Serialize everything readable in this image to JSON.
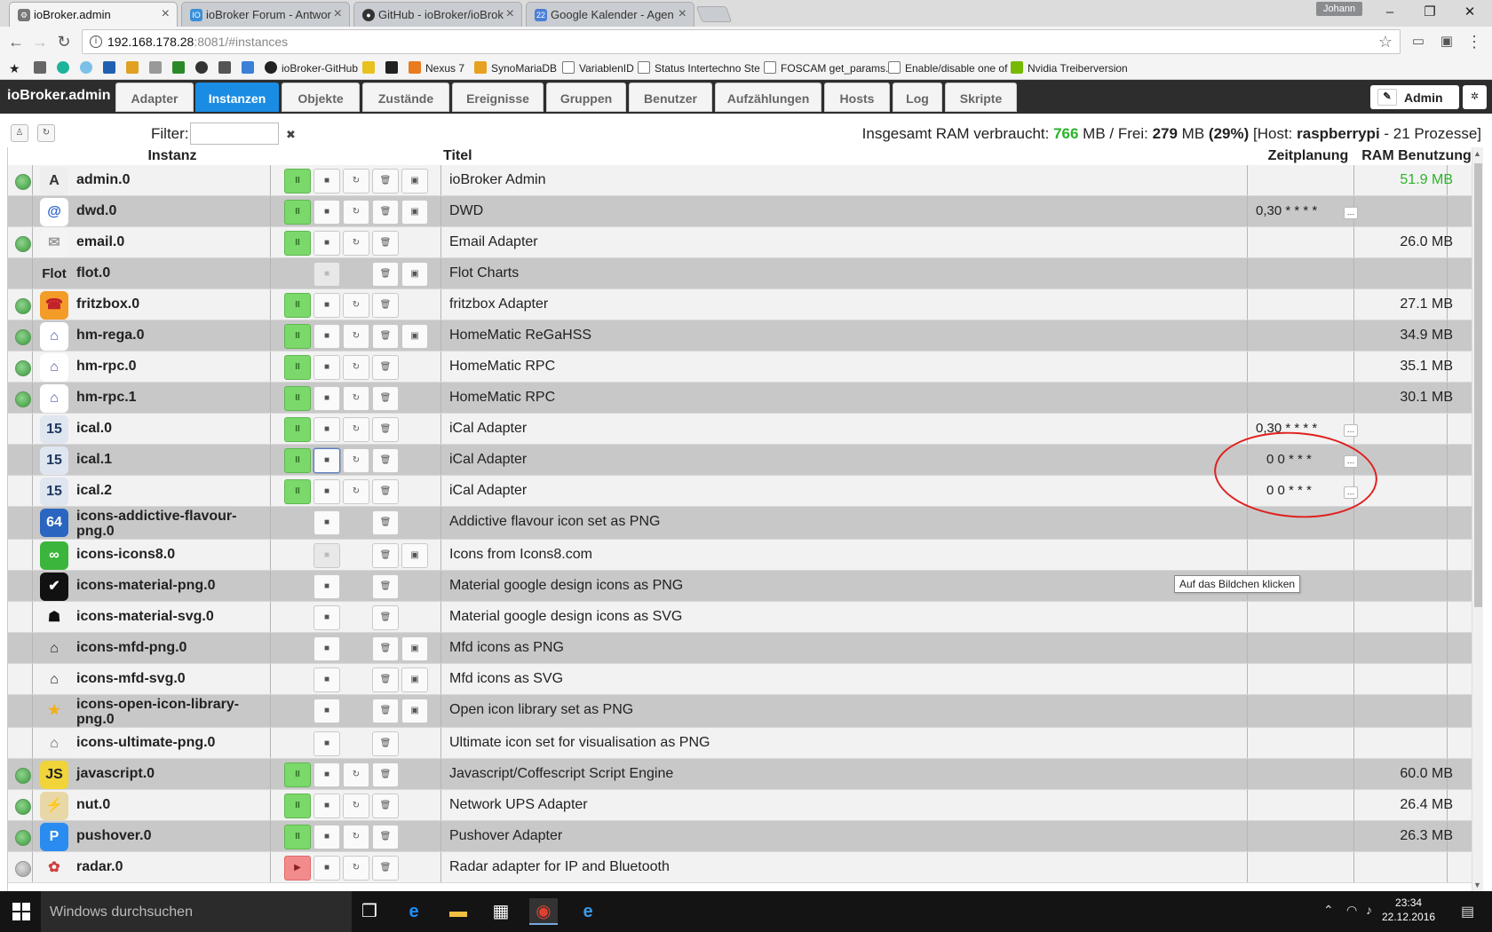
{
  "browser": {
    "tabs": [
      {
        "title": "ioBroker.admin",
        "favicon": "gear-icon"
      },
      {
        "title": "ioBroker Forum - Antwor",
        "favicon": "iob-icon"
      },
      {
        "title": "GitHub - ioBroker/ioBrok",
        "favicon": "github-icon"
      },
      {
        "title": "Google Kalender - Agen",
        "favicon": "calendar-icon"
      }
    ],
    "user_badge": "Johann",
    "url_host": "192.168.178.28",
    "url_rest": ":8081/#instances",
    "bookmarks": [
      "ioBroker-GitHub",
      "Nexus 7",
      "SynoMariaDB",
      "VariablenID",
      "Status Intertechno Ste",
      "FOSCAM get_params.",
      "Enable/disable one of",
      "Nvidia Treiberversion"
    ]
  },
  "app": {
    "name": "ioBroker.admin",
    "tabs": [
      "Adapter",
      "Instanzen",
      "Objekte",
      "Zustände",
      "Ereignisse",
      "Gruppen",
      "Benutzer",
      "Aufzählungen",
      "Hosts",
      "Log",
      "Skripte"
    ],
    "selected_tab": "Instanzen",
    "user": "Admin"
  },
  "toolbar": {
    "filter_label": "Filter:",
    "filter_value": "",
    "ram_prefix": "Insgesamt RAM verbraucht: ",
    "ram_used": "766",
    "ram_mid": " MB / Frei: ",
    "ram_free": "279",
    "ram_mid2": " MB ",
    "ram_pct": "(29%)",
    "ram_host_pre": " [Host: ",
    "ram_host": "raspberrypi",
    "ram_tail": " - 21 Prozesse]"
  },
  "table": {
    "headers": {
      "instance": "Instanz",
      "title": "Titel",
      "schedule": "Zeitplanung",
      "ram": "RAM Benutzung"
    },
    "rows": [
      {
        "name": "admin.0",
        "title": "ioBroker Admin",
        "schedule": "",
        "ram": "51.9 MB",
        "icon": "A",
        "icon_name": "gear-icon",
        "icon_bg": "#eeeeee",
        "icon_fg": "#333333"
      },
      {
        "name": "dwd.0",
        "title": "DWD",
        "schedule": "0,30 * * * *",
        "ram": "",
        "icon": "@",
        "icon_name": "weather-icon",
        "icon_bg": "#ffffff",
        "icon_fg": "#2a62c8"
      },
      {
        "name": "email.0",
        "title": "Email Adapter",
        "schedule": "",
        "ram": "26.0 MB",
        "icon": "✉",
        "icon_name": "email-icon",
        "icon_bg": "#f4f4f4",
        "icon_fg": "#999999"
      },
      {
        "name": "flot.0",
        "title": "Flot Charts",
        "schedule": "",
        "ram": "",
        "icon": "Flot",
        "icon_name": "flot-icon",
        "icon_bg": "transparent",
        "icon_fg": "#222222"
      },
      {
        "name": "fritzbox.0",
        "title": "fritzbox Adapter",
        "schedule": "",
        "ram": "27.1 MB",
        "icon": "☎",
        "icon_name": "fritzbox-icon",
        "icon_bg": "#f39c28",
        "icon_fg": "#c0202a"
      },
      {
        "name": "hm-rega.0",
        "title": "HomeMatic ReGaHSS",
        "schedule": "",
        "ram": "34.9 MB",
        "icon": "⌂",
        "icon_name": "homematic-icon",
        "icon_bg": "#ffffff",
        "icon_fg": "#4a5aa0"
      },
      {
        "name": "hm-rpc.0",
        "title": "HomeMatic RPC",
        "schedule": "",
        "ram": "35.1 MB",
        "icon": "⌂",
        "icon_name": "homematic-icon",
        "icon_bg": "#ffffff",
        "icon_fg": "#4a5aa0"
      },
      {
        "name": "hm-rpc.1",
        "title": "HomeMatic RPC",
        "schedule": "",
        "ram": "30.1 MB",
        "icon": "⌂",
        "icon_name": "homematic-icon",
        "icon_bg": "#ffffff",
        "icon_fg": "#4a5aa0"
      },
      {
        "name": "ical.0",
        "title": "iCal Adapter",
        "schedule": "0,30 * * * *",
        "ram": "",
        "icon": "15",
        "icon_name": "calendar-icon",
        "icon_bg": "#dfe6f0",
        "icon_fg": "#1f3860"
      },
      {
        "name": "ical.1",
        "title": "iCal Adapter",
        "schedule": "0 0 * * *",
        "ram": "",
        "icon": "15",
        "icon_name": "calendar-icon",
        "icon_bg": "#dfe6f0",
        "icon_fg": "#1f3860"
      },
      {
        "name": "ical.2",
        "title": "iCal Adapter",
        "schedule": "0 0 * * *",
        "ram": "",
        "icon": "15",
        "icon_name": "calendar-icon",
        "icon_bg": "#dfe6f0",
        "icon_fg": "#1f3860"
      },
      {
        "name": "icons-addictive-flavour-png.0",
        "title": "Addictive flavour icon set as PNG",
        "schedule": "",
        "ram": "",
        "icon": "64",
        "icon_name": "shield-icon",
        "icon_bg": "#2a66c0",
        "icon_fg": "#ffffff"
      },
      {
        "name": "icons-icons8.0",
        "title": "Icons from Icons8.com",
        "schedule": "",
        "ram": "",
        "icon": "∞",
        "icon_name": "icons8-icon",
        "icon_bg": "#3cb53c",
        "icon_fg": "#ffffff"
      },
      {
        "name": "icons-material-png.0",
        "title": "Material google design icons as PNG",
        "schedule": "",
        "ram": "",
        "icon": "✔",
        "icon_name": "cloud-check-icon",
        "icon_bg": "#111111",
        "icon_fg": "#ffffff"
      },
      {
        "name": "icons-material-svg.0",
        "title": "Material google design icons as SVG",
        "schedule": "",
        "ram": "",
        "icon": "☗",
        "icon_name": "android-icon",
        "icon_bg": "transparent",
        "icon_fg": "#111111"
      },
      {
        "name": "icons-mfd-png.0",
        "title": "Mfd icons as PNG",
        "schedule": "",
        "ram": "",
        "icon": "⌂",
        "icon_name": "house-icon",
        "icon_bg": "transparent",
        "icon_fg": "#222222"
      },
      {
        "name": "icons-mfd-svg.0",
        "title": "Mfd icons as SVG",
        "schedule": "",
        "ram": "",
        "icon": "⌂",
        "icon_name": "house-icon",
        "icon_bg": "transparent",
        "icon_fg": "#222222"
      },
      {
        "name": "icons-open-icon-library-png.0",
        "title": "Open icon library set as PNG",
        "schedule": "",
        "ram": "",
        "icon": "★",
        "icon_name": "star-icon",
        "icon_bg": "transparent",
        "icon_fg": "#f0b020"
      },
      {
        "name": "icons-ultimate-png.0",
        "title": "Ultimate icon set for visualisation as PNG",
        "schedule": "",
        "ram": "",
        "icon": "⌂",
        "icon_name": "home-icon",
        "icon_bg": "transparent",
        "icon_fg": "#666666"
      },
      {
        "name": "javascript.0",
        "title": "Javascript/Coffescript Script Engine",
        "schedule": "",
        "ram": "60.0 MB",
        "icon": "JS",
        "icon_name": "javascript-icon",
        "icon_bg": "#f0d43a",
        "icon_fg": "#222222"
      },
      {
        "name": "nut.0",
        "title": "Network UPS Adapter",
        "schedule": "",
        "ram": "26.4 MB",
        "icon": "⚡",
        "icon_name": "ups-icon",
        "icon_bg": "#e8d8a8",
        "icon_fg": "#805020"
      },
      {
        "name": "pushover.0",
        "title": "Pushover Adapter",
        "schedule": "",
        "ram": "26.3 MB",
        "icon": "P",
        "icon_name": "pushover-icon",
        "icon_bg": "#2a8cf0",
        "icon_fg": "#ffffff"
      },
      {
        "name": "radar.0",
        "title": "Radar adapter for IP and Bluetooth",
        "schedule": "",
        "ram": "",
        "icon": "✿",
        "icon_name": "radar-icon",
        "icon_bg": "transparent",
        "icon_fg": "#d04040"
      }
    ]
  },
  "tooltip": "Auf das Bildchen klicken",
  "taskbar": {
    "search_placeholder": "Windows durchsuchen",
    "time": "23:34",
    "date": "22.12.2016"
  }
}
